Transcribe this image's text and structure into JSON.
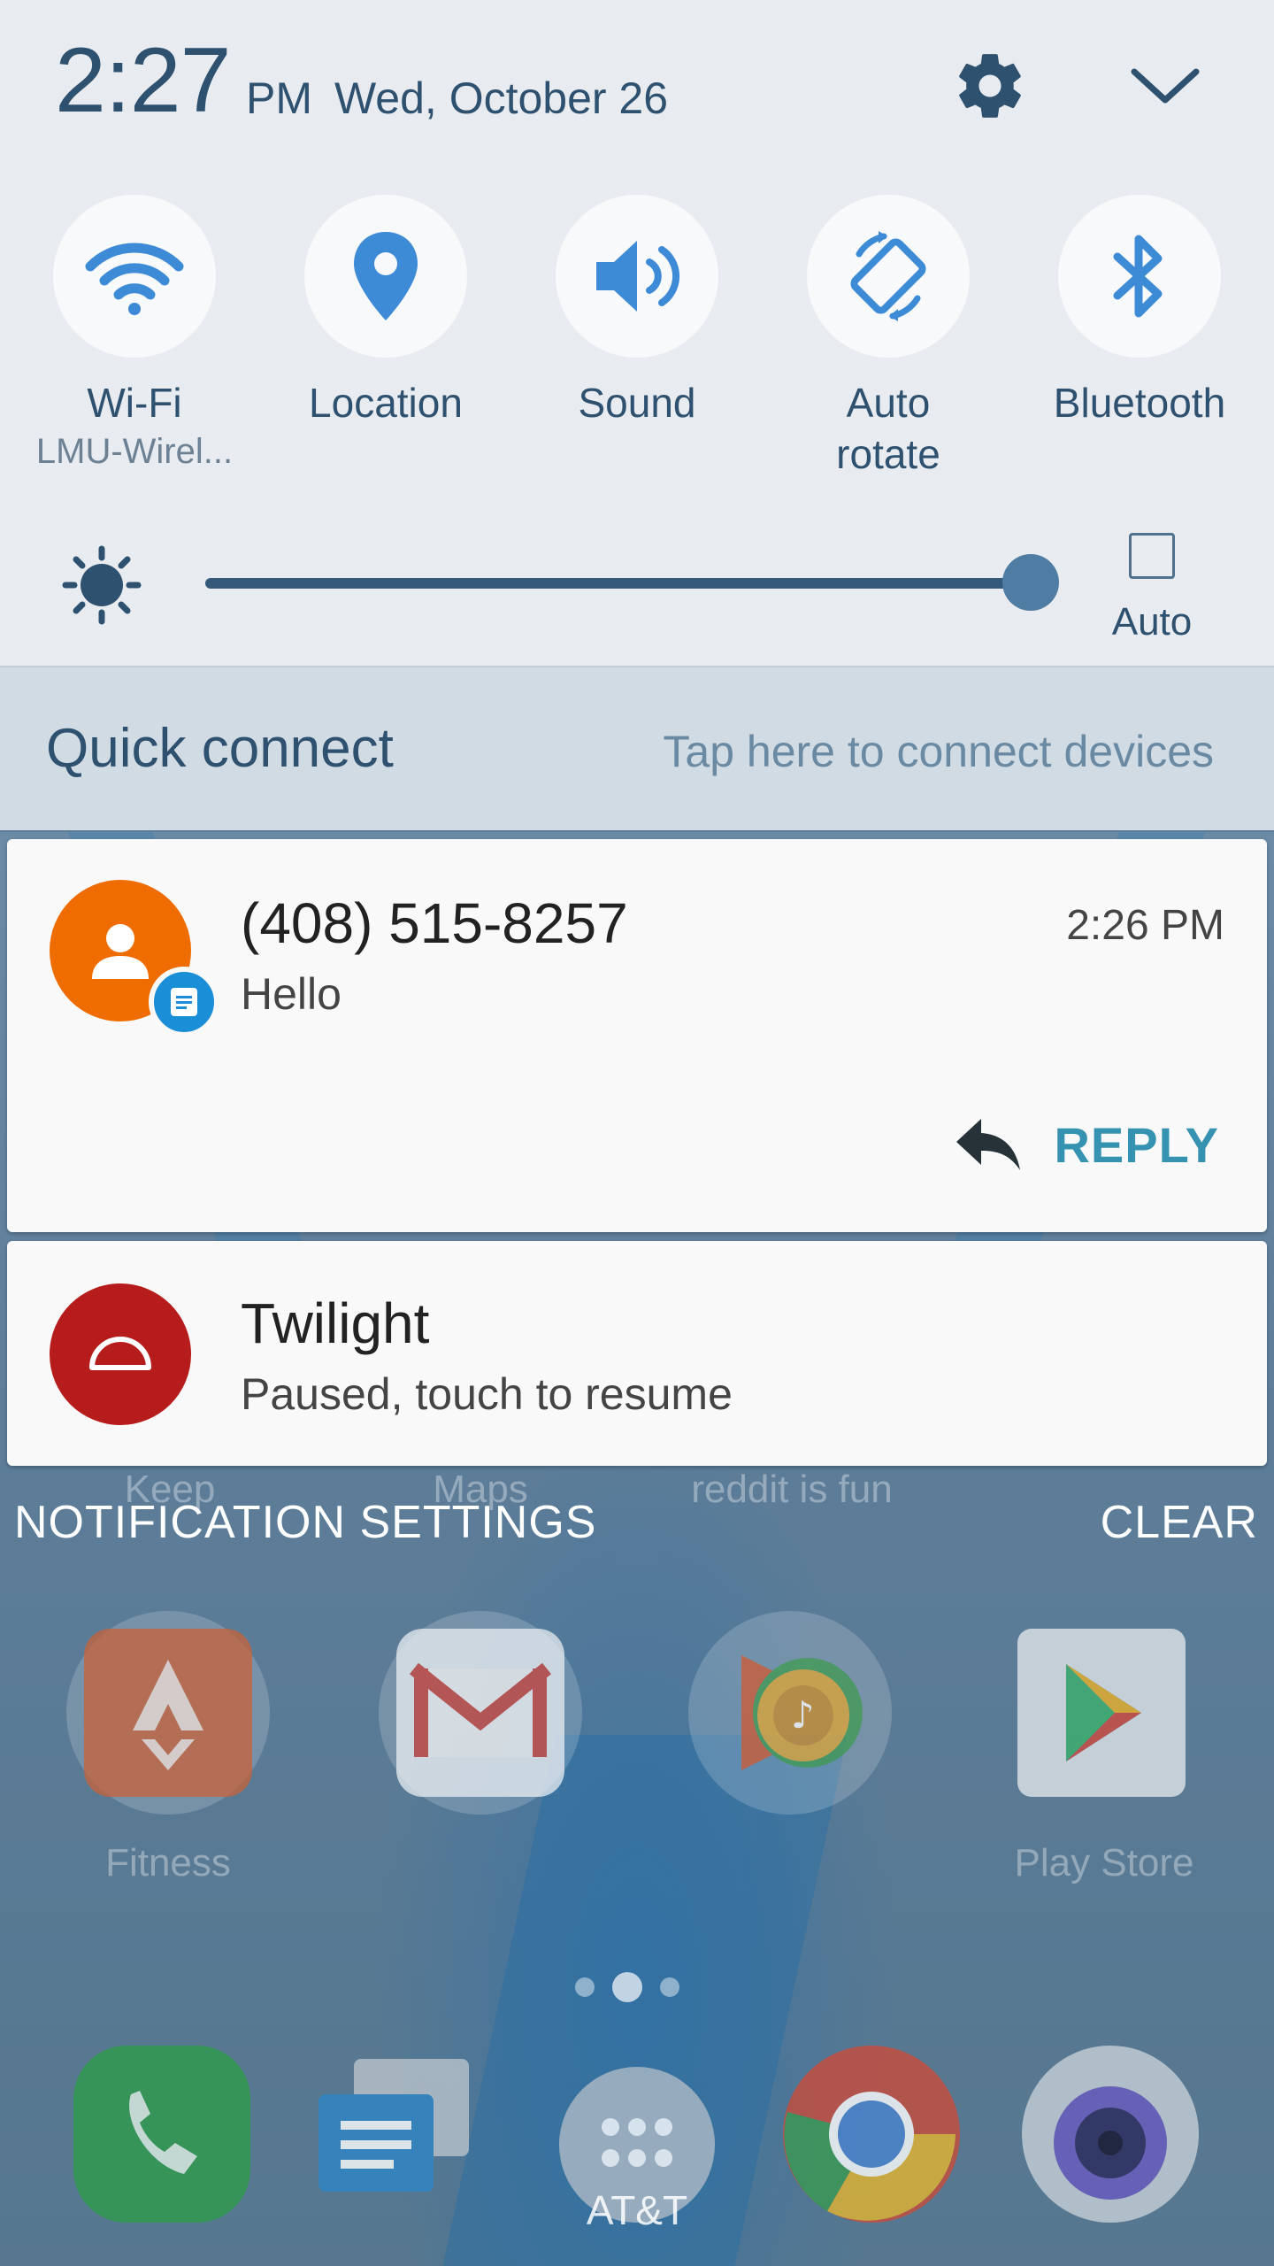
{
  "status": {
    "time": "2:27",
    "ampm": "PM",
    "date": "Wed, October 26"
  },
  "top_icons": {
    "settings": "gear-icon",
    "expand": "chevron-down-icon"
  },
  "toggles": [
    {
      "label": "Wi-Fi",
      "sub": "LMU-Wirel...",
      "icon": "wifi-icon",
      "active": true
    },
    {
      "label": "Location",
      "sub": "",
      "icon": "location-icon",
      "active": true
    },
    {
      "label": "Sound",
      "sub": "",
      "icon": "sound-icon",
      "active": true
    },
    {
      "label": "Auto rotate",
      "sub": "",
      "icon": "auto-rotate-icon",
      "active": true
    },
    {
      "label": "Bluetooth",
      "sub": "",
      "icon": "bluetooth-icon",
      "active": true
    }
  ],
  "brightness": {
    "level": 0.98,
    "auto_label": "Auto",
    "auto_checked": false
  },
  "quick_connect": {
    "title": "Quick connect",
    "hint": "Tap here to connect devices"
  },
  "notifications": [
    {
      "title": "(408) 515-8257",
      "text": "Hello",
      "time": "2:26 PM",
      "action": "REPLY",
      "avatar_color": "#ef6c00",
      "badge_color": "#1a8ed6"
    },
    {
      "title": "Twilight",
      "text": "Paused, touch to resume",
      "avatar_color": "#b71c1c"
    }
  ],
  "actions": {
    "settings": "NOTIFICATION SETTINGS",
    "clear": "CLEAR"
  },
  "home": {
    "top_labels": [
      "Keep",
      "Maps",
      "reddit is fun"
    ],
    "apps": [
      {
        "label": "Fitness"
      },
      {
        "label": ""
      },
      {
        "label": ""
      },
      {
        "label": "Play Store"
      }
    ],
    "carrier": "AT&T"
  },
  "colors": {
    "panel_bg": "#e8ecf0",
    "accent": "#2f5170",
    "icon_blue": "#3d8bd6",
    "reply": "#3592b0"
  }
}
